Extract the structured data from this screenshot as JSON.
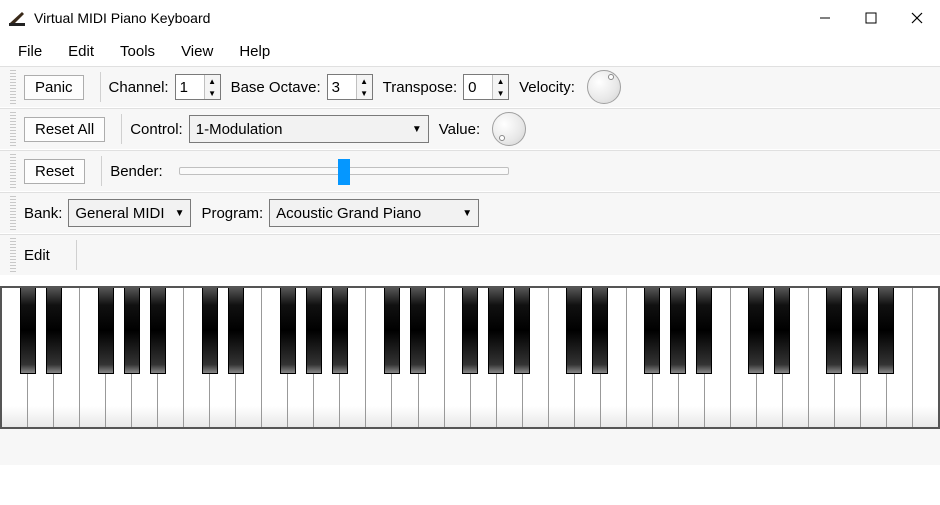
{
  "window": {
    "title": "Virtual MIDI Piano Keyboard"
  },
  "menu": {
    "file": "File",
    "edit": "Edit",
    "tools": "Tools",
    "view": "View",
    "help": "Help"
  },
  "row1": {
    "panic": "Panic",
    "channel_label": "Channel:",
    "channel_value": "1",
    "baseoctave_label": "Base Octave:",
    "baseoctave_value": "3",
    "transpose_label": "Transpose:",
    "transpose_value": "0",
    "velocity_label": "Velocity:"
  },
  "row2": {
    "reset_all": "Reset All",
    "control_label": "Control:",
    "control_value": "1-Modulation",
    "value_label": "Value:"
  },
  "row3": {
    "reset": "Reset",
    "bender_label": "Bender:"
  },
  "row4": {
    "bank_label": "Bank:",
    "bank_value": "General MIDI",
    "program_label": "Program:",
    "program_value": "Acoustic Grand Piano"
  },
  "row5": {
    "edit": "Edit"
  },
  "keyboard": {
    "white_key_count": 36
  }
}
